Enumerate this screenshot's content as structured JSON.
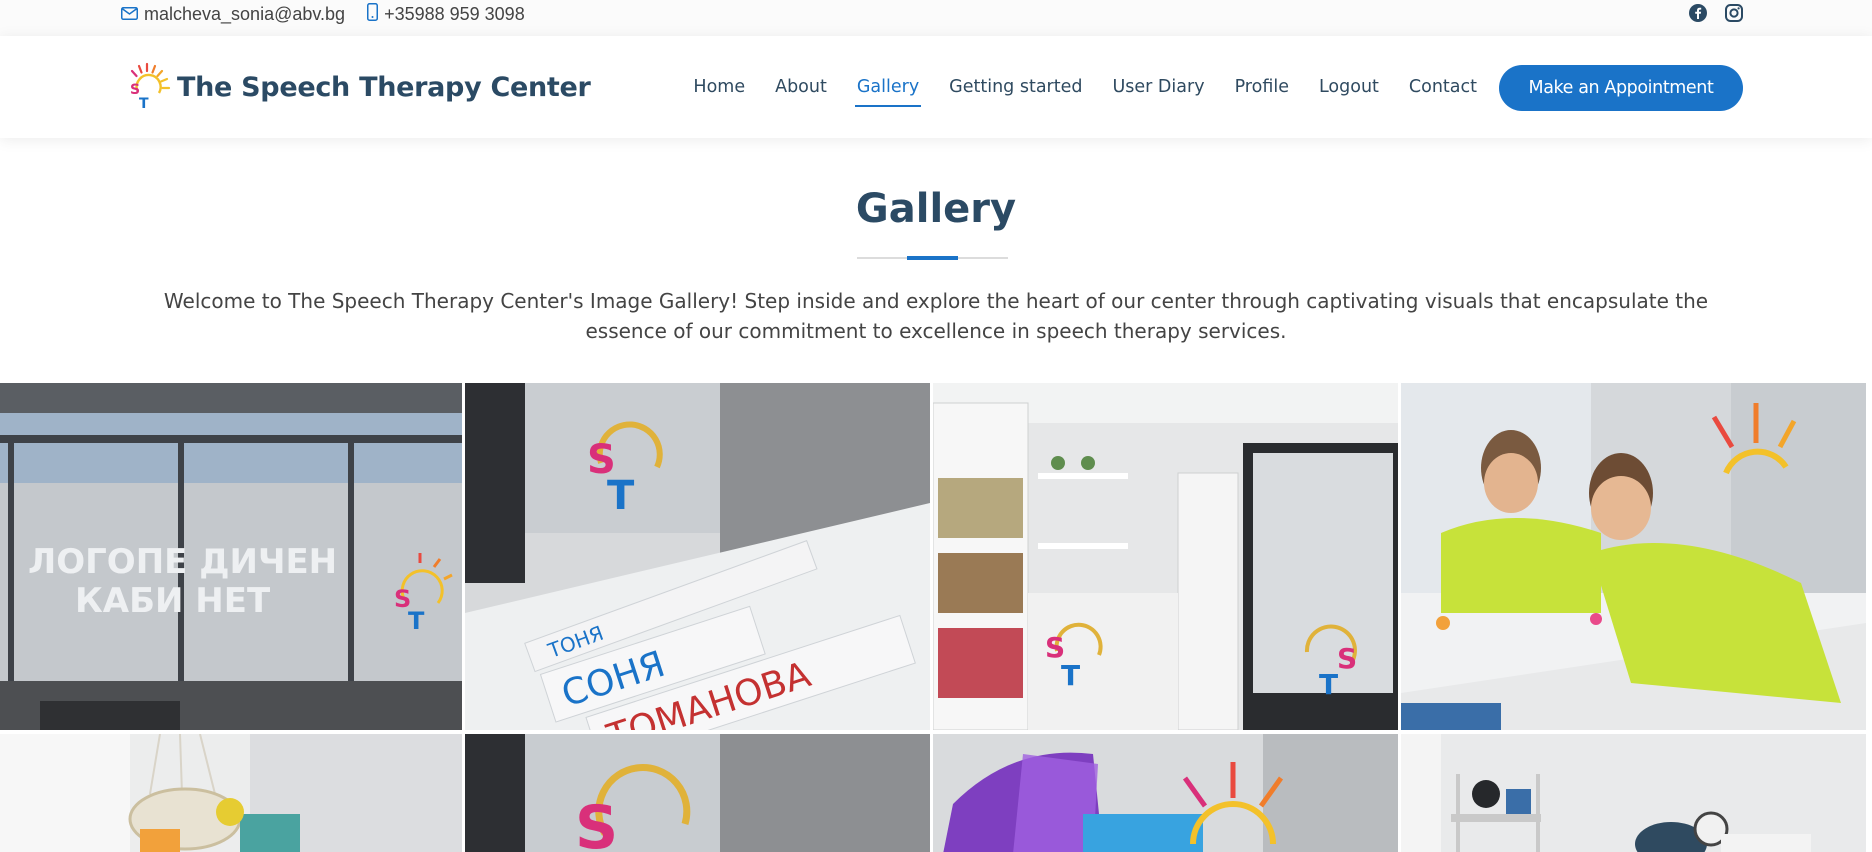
{
  "topbar": {
    "email": "malcheva_sonia@abv.bg",
    "phone": "+35988 959 3098",
    "social": [
      "facebook-icon",
      "instagram-icon"
    ]
  },
  "header": {
    "brand_name": "The Speech Therapy Center",
    "nav": [
      {
        "label": "Home",
        "active": false
      },
      {
        "label": "About",
        "active": false
      },
      {
        "label": "Gallery",
        "active": true
      },
      {
        "label": "Getting started",
        "active": false
      },
      {
        "label": "User Diary",
        "active": false
      },
      {
        "label": "Profile",
        "active": false
      },
      {
        "label": "Logout",
        "active": false
      },
      {
        "label": "Contact",
        "active": false
      }
    ],
    "cta_label": "Make an Appointment"
  },
  "gallery": {
    "title": "Gallery",
    "intro": "Welcome to The Speech Therapy Center's Image Gallery! Step inside and explore the heart of our center through captivating visuals that encapsulate the essence of our commitment to excellence in speech therapy services.",
    "photos": [
      {
        "subject": "office-window-sign-photo",
        "sign_line1": "ЛОГОПЕ ДИЧЕН",
        "sign_line2": "КАБИ НЕТ"
      },
      {
        "subject": "letter-cards-on-desk-photo",
        "cards_top": "ТОНЯ",
        "cards_row1": "СОНЯ",
        "cards_row2": "ТОМАНОВА"
      },
      {
        "subject": "therapy-room-shelves-photo"
      },
      {
        "subject": "children-at-table-photo"
      },
      {
        "subject": "swing-chair-toys-photo"
      },
      {
        "subject": "logo-on-glass-photo"
      },
      {
        "subject": "purple-folder-logo-photo"
      },
      {
        "subject": "room-shelf-cart-photo"
      }
    ]
  },
  "colors": {
    "accent": "#1a73c8",
    "heading": "#2b4a64",
    "text": "#444444"
  }
}
